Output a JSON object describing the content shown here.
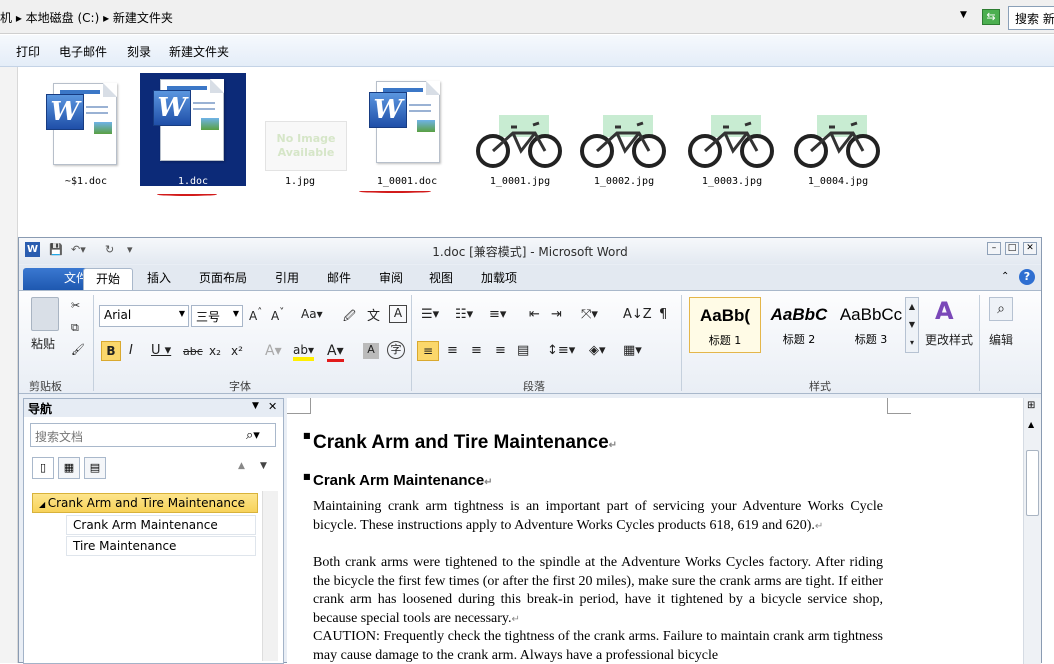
{
  "explorer": {
    "address": "机 ▸ 本地磁盘 (C:) ▸ 新建文件夹",
    "search_label": "搜索 新",
    "commands": [
      "打印",
      "电子邮件",
      "刻录",
      "新建文件夹"
    ],
    "files": [
      {
        "name": "~$1.doc",
        "type": "doc"
      },
      {
        "name": "1.doc",
        "type": "doc",
        "selected": true
      },
      {
        "name": "1.jpg",
        "type": "noimage",
        "thumb_text": "No Image Available"
      },
      {
        "name": "1_0001.doc",
        "type": "doc"
      },
      {
        "name": "1_0001.jpg",
        "type": "bike"
      },
      {
        "name": "1_0002.jpg",
        "type": "bike"
      },
      {
        "name": "1_0003.jpg",
        "type": "bike"
      },
      {
        "name": "1_0004.jpg",
        "type": "bike"
      }
    ]
  },
  "word": {
    "title": "1.doc [兼容模式] - Microsoft Word",
    "tabs": [
      "文件",
      "开始",
      "插入",
      "页面布局",
      "引用",
      "邮件",
      "审阅",
      "视图",
      "加载项"
    ],
    "clipboard": {
      "paste_label": "粘贴",
      "group_label": "剪贴板"
    },
    "font": {
      "name": "Arial",
      "size": "三号",
      "group_label": "字体"
    },
    "paragraph": {
      "group_label": "段落"
    },
    "styles": {
      "group_label": "样式",
      "tiles": [
        {
          "preview": "AaBb(",
          "label": "标题 1"
        },
        {
          "preview": "AaBbC",
          "label": "标题 2"
        },
        {
          "preview": "AaBbCc",
          "label": "标题 3"
        }
      ],
      "change_styles": "更改样式"
    },
    "editing": {
      "label": "编辑"
    },
    "nav": {
      "title": "导航",
      "search_placeholder": "搜索文档",
      "items": [
        "Crank Arm and Tire Maintenance",
        "Crank Arm Maintenance",
        "Tire Maintenance"
      ]
    },
    "document": {
      "heading1": "Crank Arm and Tire Maintenance",
      "heading2": "Crank Arm Maintenance",
      "para1": "Maintaining crank arm tightness is an important part of servicing your Adventure Works Cycle bicycle. These instructions apply to Adventure Works Cycles products 618, 619 and 620).",
      "para2": "Both crank arms were tightened to the spindle at the Adventure Works Cycles factory. After riding the bicycle the first few times (or after the first 20 miles), make sure the crank arms are tight. If either crank arm has loosened during this break-in period, have it tightened by a bicycle service shop, because special tools are necessary.",
      "para3": "CAUTION: Frequently check the tightness of the crank arms. Failure to maintain crank arm tightness may cause damage to the crank arm. Always have a professional bicycle"
    }
  }
}
